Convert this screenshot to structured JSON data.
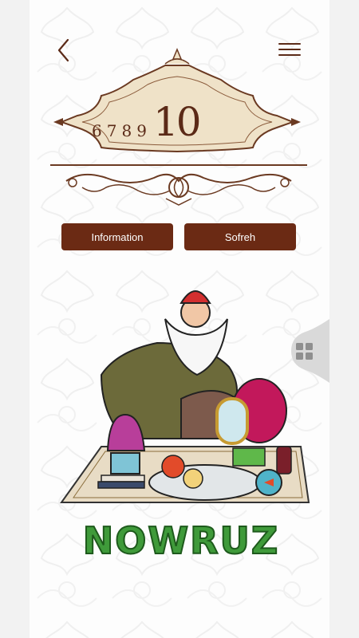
{
  "header": {
    "back_icon": "chevron-left-icon",
    "menu_icon": "hamburger-menu-icon"
  },
  "countdown": {
    "small_digits": [
      "6",
      "7",
      "8",
      "9"
    ],
    "current": "10"
  },
  "buttons": {
    "information": "Information",
    "sofreh": "Sofreh"
  },
  "side_tab": {
    "icon": "grid-icon"
  },
  "hero": {
    "title": "NOWRUZ"
  },
  "colors": {
    "brand_brown": "#6b2a14",
    "title_green": "#3f9a3a",
    "plaque_fill": "#efe2c8"
  }
}
